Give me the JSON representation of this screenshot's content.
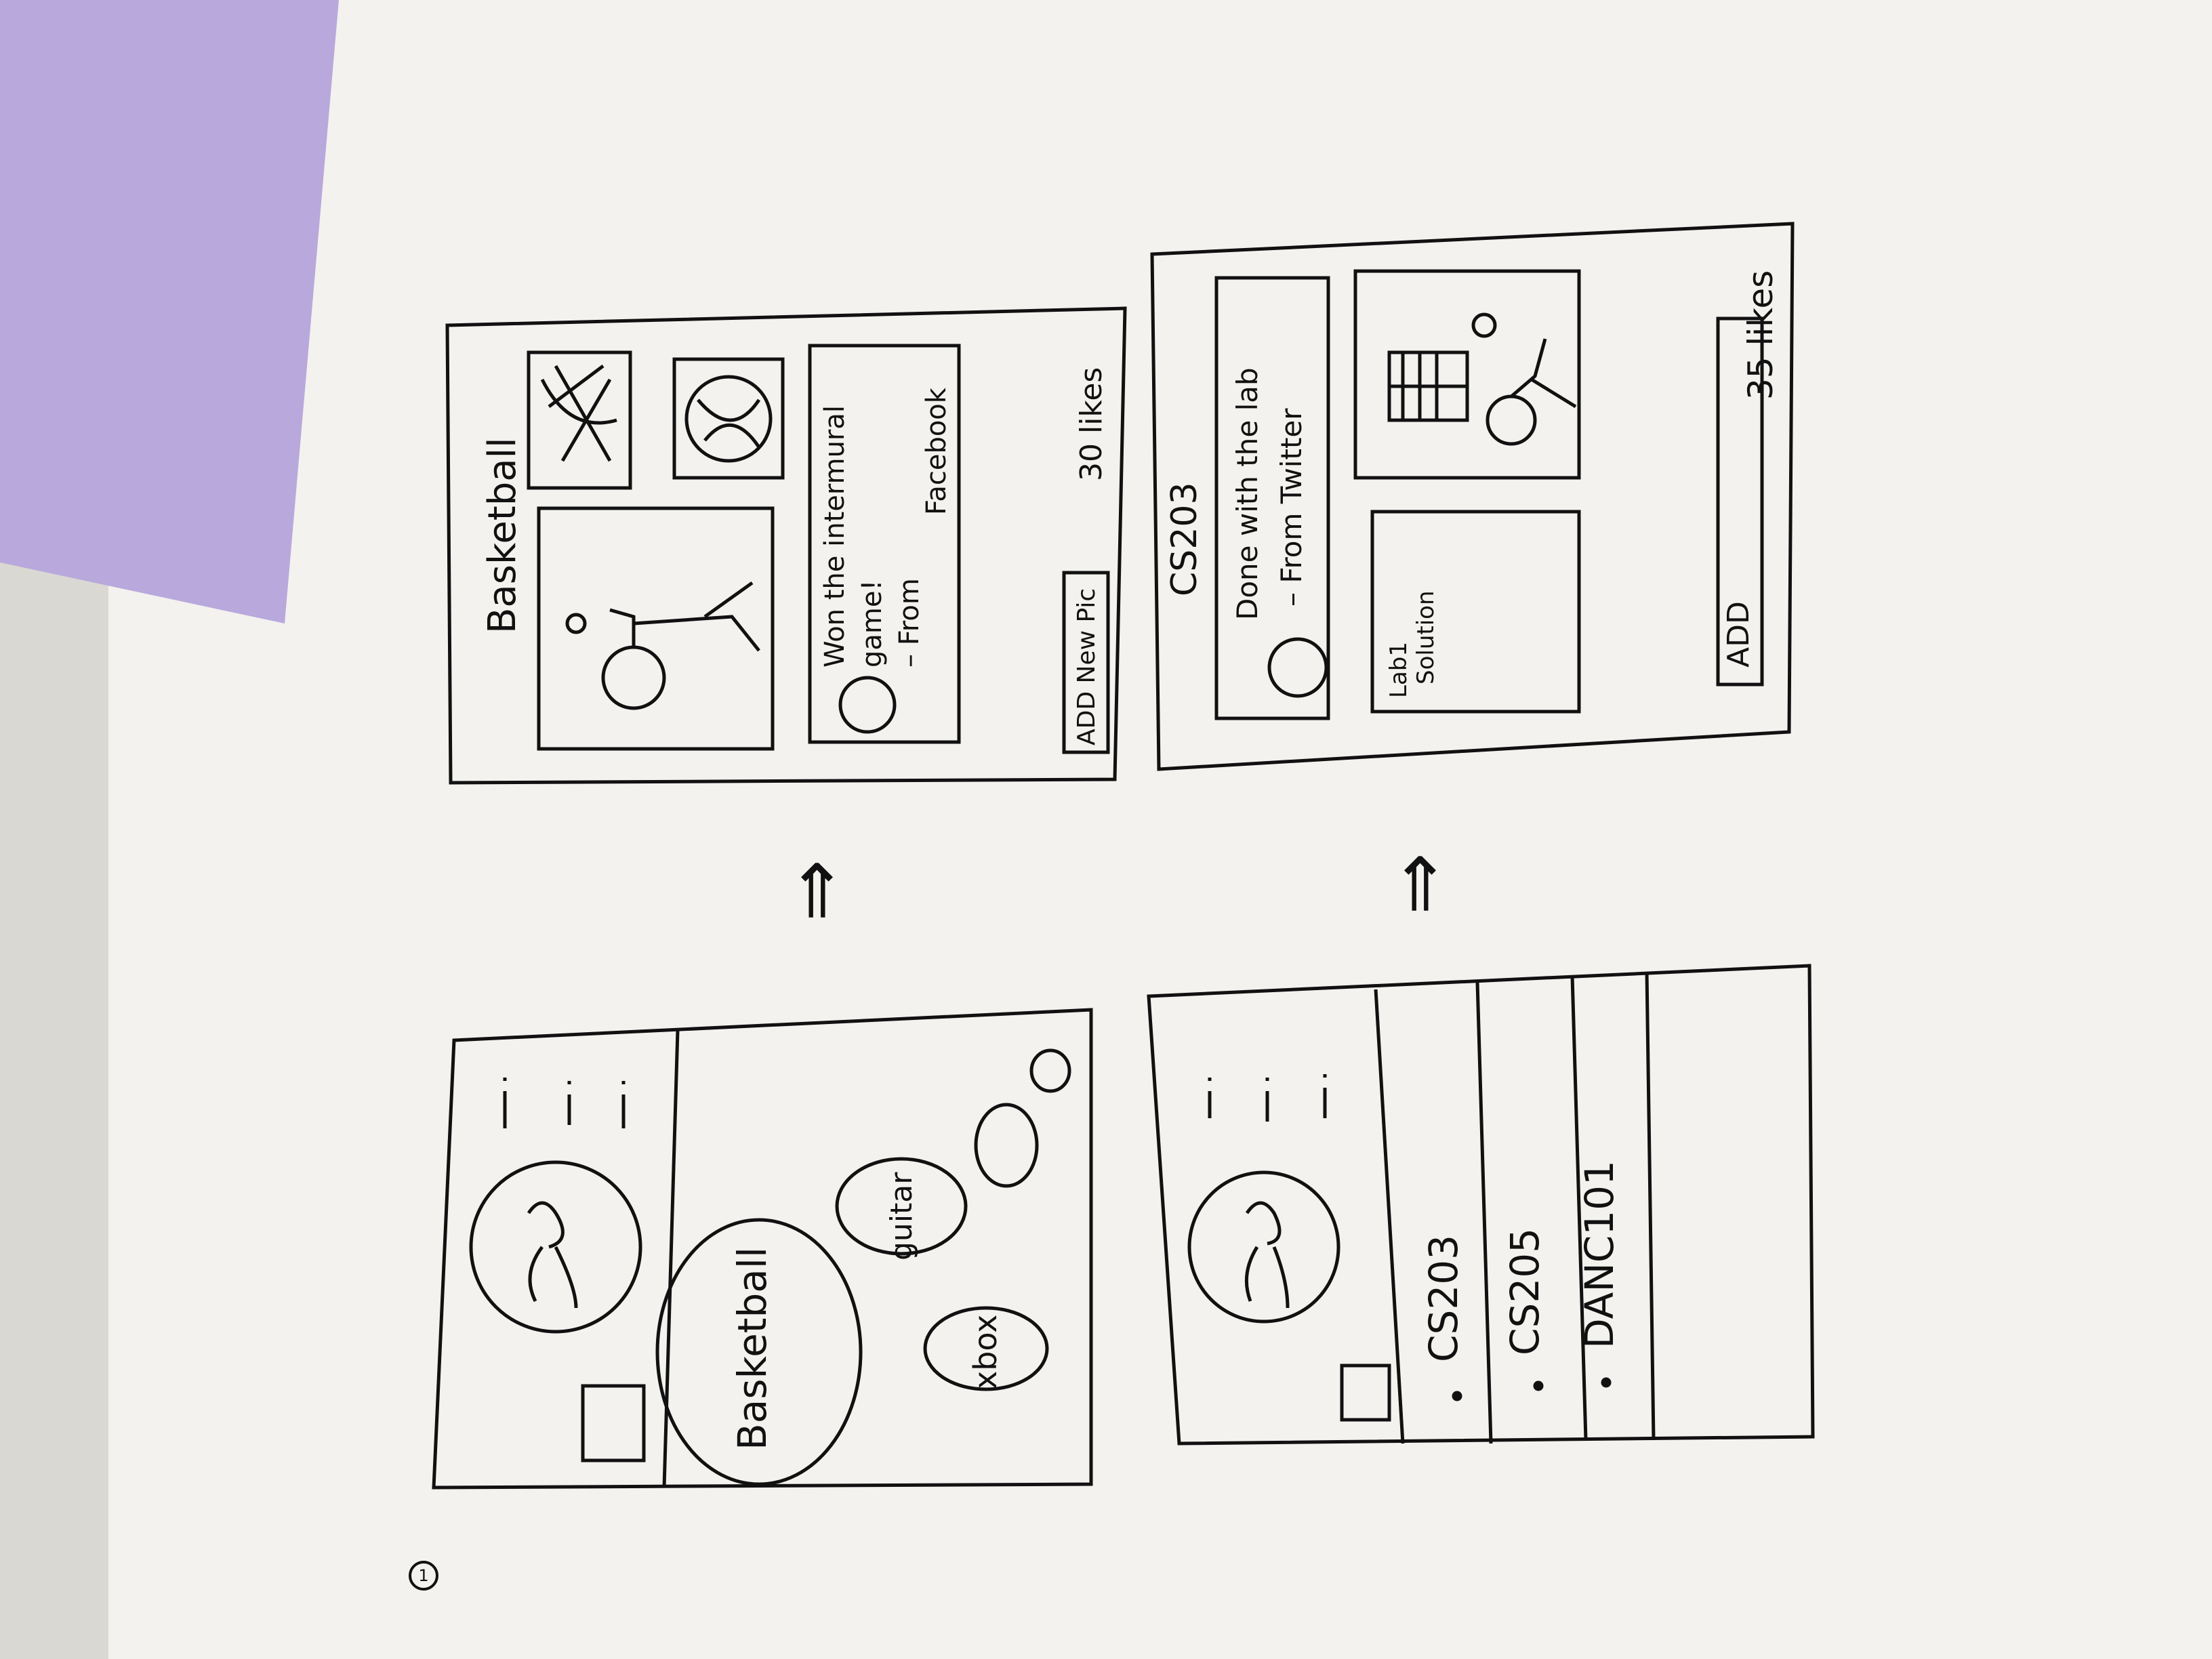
{
  "page_number": "1",
  "arrows": {
    "top": "⇒",
    "bottom": "⇒"
  },
  "profile_hobbies": {
    "bubbles": [
      "Basketball",
      "guitar",
      "xbox"
    ]
  },
  "hobby_detail": {
    "title": "Basketball",
    "post_text_line1": "Won the intermural",
    "post_text_line2": "game!",
    "post_source_line1": "– From",
    "post_source_line2": "Facebook",
    "add_button": "ADD New Pic",
    "likes": "30 likes"
  },
  "profile_courses": {
    "courses": [
      "CS203",
      "CS205",
      "DANC101"
    ]
  },
  "course_detail": {
    "title": "CS203",
    "post_text": "Done with the lab",
    "post_source": "– From Twitter",
    "file_label_line1": "Lab1",
    "file_label_line2": "Solution",
    "add_button": "ADD",
    "likes": "35 likes"
  },
  "colors": {
    "paper": "#f3f2ee",
    "ink": "#111111",
    "sticky_note": "#b9a8dc",
    "background": "#e9e8e2"
  }
}
